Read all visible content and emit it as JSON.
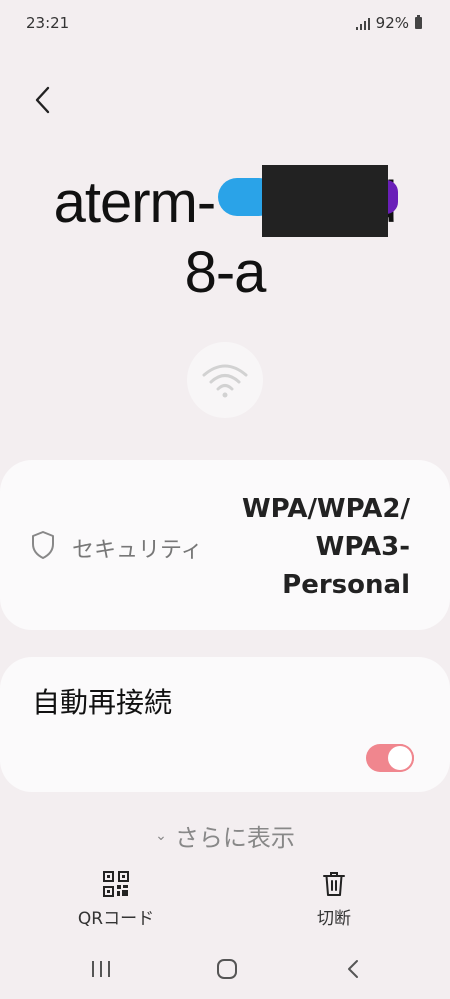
{
  "status_bar": {
    "time": "23:21",
    "battery": "92%"
  },
  "header": {
    "back_icon": "chevron-left-icon"
  },
  "network": {
    "name_line1": "aterm-",
    "name_line1_end": "d",
    "name_line2": "8-a",
    "icon": "wifi-icon"
  },
  "security": {
    "label": "セキュリティ",
    "value_lines": [
      "WPA/WPA2/",
      "WPA3-",
      "Personal"
    ],
    "icon": "shield-icon"
  },
  "auto_reconnect": {
    "label": "自動再接続",
    "enabled": true
  },
  "show_more": {
    "label": "さらに表示"
  },
  "actions": {
    "qr_label": "QRコード",
    "disconnect_label": "切断"
  },
  "colors": {
    "background": "#f3eef0",
    "card": "#fbfafb",
    "toggle_on": "#f0868e"
  }
}
